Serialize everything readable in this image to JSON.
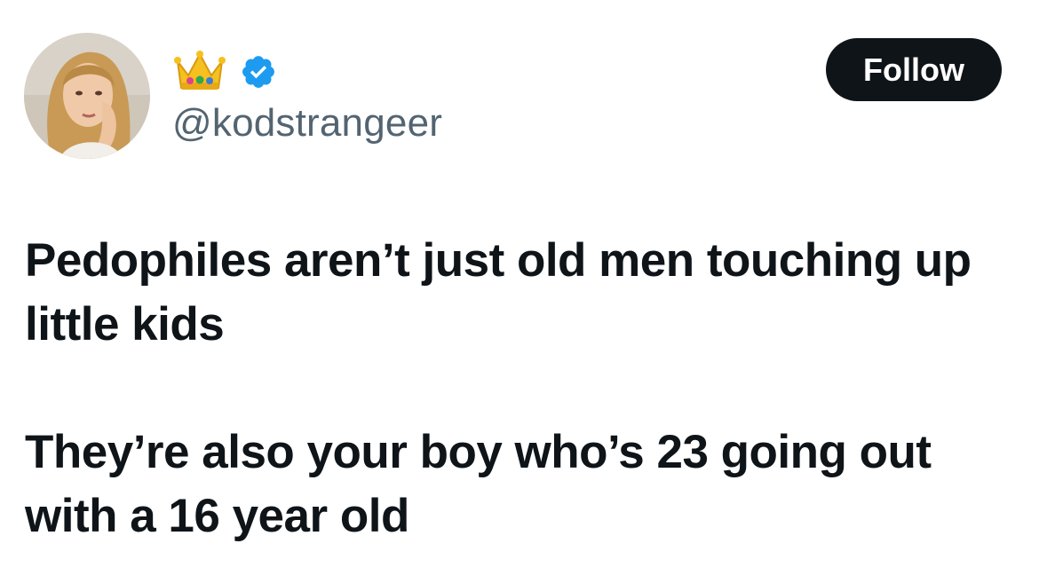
{
  "author": {
    "display_name_emoji": "crown-icon",
    "verified": true,
    "handle": "@kodstrangeer"
  },
  "follow_button": {
    "label": "Follow"
  },
  "tweet": {
    "paragraph_1": "Pedophiles aren’t just old men touching up little kids",
    "paragraph_2": "They’re also your boy who’s 23 going out with a 16 year old"
  },
  "colors": {
    "text": "#0f1419",
    "handle": "#536471",
    "verified": "#1d9bf0",
    "button_bg": "#0f1419",
    "button_text": "#ffffff"
  }
}
